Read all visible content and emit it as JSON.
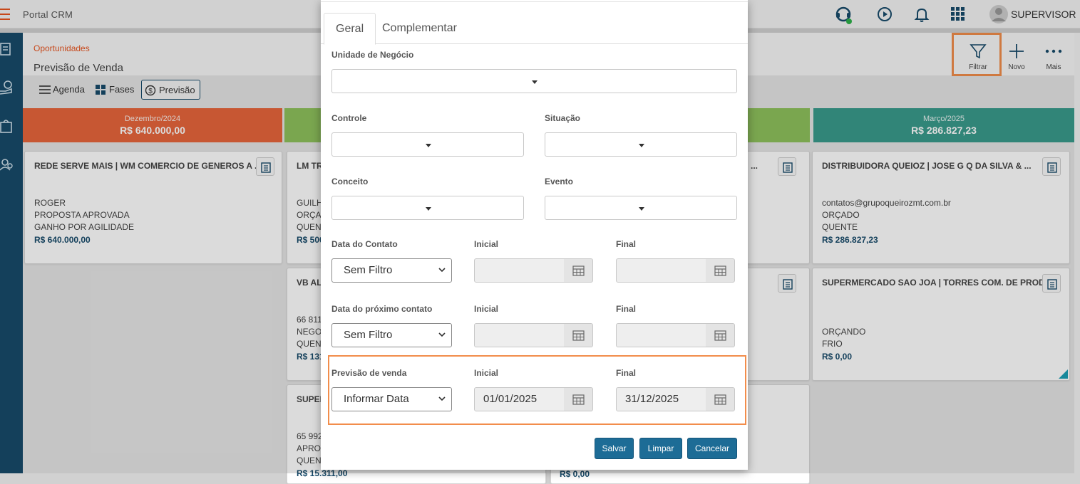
{
  "app": {
    "title": "Portal CRM",
    "user": "SUPERVISOR"
  },
  "topbar_icons": [
    "support-icon",
    "play-circle-icon",
    "bell-icon",
    "apps-grid-icon"
  ],
  "sidebar": {
    "icons": [
      "kanban-icon",
      "money-hand-icon",
      "bag-icon",
      "search-person-icon"
    ]
  },
  "header": {
    "breadcrumb": "Oportunidades",
    "title": "Previsão de Venda"
  },
  "actions": {
    "filtrar": "Filtrar",
    "novo": "Novo",
    "mais": "Mais"
  },
  "views": {
    "agenda": "Agenda",
    "fases": "Fases",
    "previsao": "Previsão"
  },
  "columns": [
    {
      "month": "Dezembro/2024",
      "value": "R$ 640.000,00",
      "color": "#e8663c"
    },
    {
      "month": "",
      "value": "",
      "color": "#8fc25d"
    },
    {
      "month": "",
      "value": "",
      "color": "#8fc25d"
    },
    {
      "month": "Março/2025",
      "value": "R$ 286.827,23",
      "color": "#3a9b8c"
    }
  ],
  "cards": {
    "c1": {
      "title": "REDE SERVE MAIS | WM COMERCIO DE GENEROS A ...",
      "l1": "ROGER",
      "l2": "PROPOSTA APROVADA",
      "l3": "GANHO POR AGILIDADE",
      "value": "R$ 640.000,00"
    },
    "c2": {
      "title": "LM TR",
      "l1": "GUILH",
      "l2": "ORÇAD",
      "l3": "QUENT",
      "value": "R$ 500"
    },
    "c3": {
      "title": "VB AL",
      "l1": "66 811",
      "l2": "NEGOC",
      "l3": "QUENT",
      "value": "R$ 131"
    },
    "c4": {
      "title": "SUPER",
      "l1": "65 992",
      "l2": "APROV",
      "l3": "QUENT",
      "value": "R$ 15.311,00"
    },
    "c5": {
      "title": "DISTRIBUIDORA QUEIOZ | JOSE G Q DA SILVA & ...",
      "l1": "contatos@grupoqueirozmt.com.br",
      "l2": "ORÇADO",
      "l3": "QUENTE",
      "value": "R$ 286.827,23"
    },
    "c6": {
      "title": "SUPERMERCADO SAO JOA | TORRES COM. DE PROD ...",
      "l1": "ORÇANDO",
      "l2": "FRIO",
      "value": "R$ 0,00"
    },
    "c7": {
      "title": "...",
      "value": "R$ 0,00"
    }
  },
  "modal": {
    "tabs": {
      "geral": "Geral",
      "complementar": "Complementar"
    },
    "unidade": {
      "label": "Unidade de Negócio"
    },
    "controle": {
      "label": "Controle"
    },
    "situacao": {
      "label": "Situação"
    },
    "conceito": {
      "label": "Conceito"
    },
    "evento": {
      "label": "Evento"
    },
    "data_contato": {
      "label": "Data do Contato",
      "select": "Sem Filtro",
      "inicial_label": "Inicial",
      "final_label": "Final",
      "inicial": "",
      "final": ""
    },
    "data_proximo": {
      "label": "Data do próximo contato",
      "select": "Sem Filtro",
      "inicial_label": "Inicial",
      "final_label": "Final",
      "inicial": "",
      "final": ""
    },
    "previsao": {
      "label": "Previsão de venda",
      "select": "Informar Data",
      "inicial_label": "Inicial",
      "final_label": "Final",
      "inicial": "01/01/2025",
      "final": "31/12/2025"
    },
    "buttons": {
      "salvar": "Salvar",
      "limpar": "Limpar",
      "cancelar": "Cancelar"
    }
  }
}
